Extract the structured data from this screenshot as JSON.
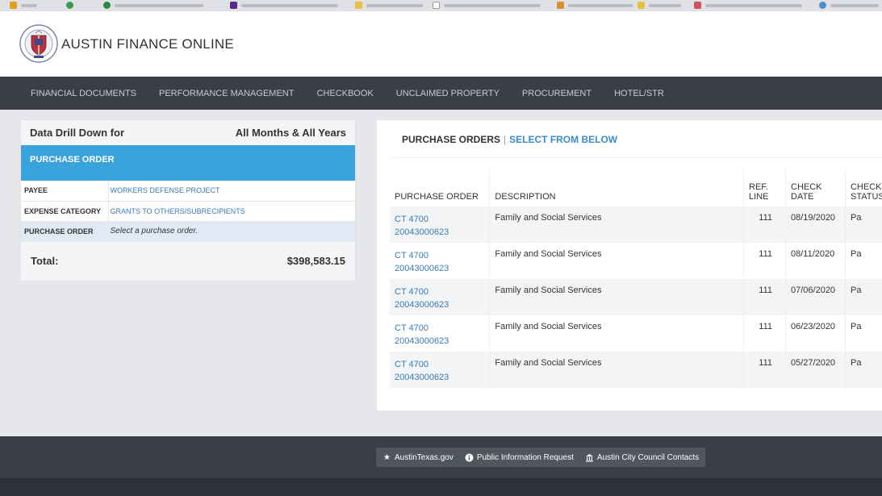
{
  "app": {
    "title": "AUSTIN FINANCE ONLINE"
  },
  "nav": {
    "items": [
      "FINANCIAL DOCUMENTS",
      "PERFORMANCE MANAGEMENT",
      "CHECKBOOK",
      "UNCLAIMED PROPERTY",
      "PROCUREMENT",
      "HOTEL/STR"
    ]
  },
  "drill": {
    "heading": "Data Drill Down for",
    "scope": "All Months & All Years",
    "banner": "PURCHASE ORDER",
    "filters": [
      {
        "key": "PAYEE",
        "value": "WORKERS DEFENSE PROJECT"
      },
      {
        "key": "EXPENSE CATEGORY",
        "value": "GRANTS TO OTHERS/SUBRECIPIENTS"
      },
      {
        "key": "PURCHASE ORDER",
        "value": "Select a purchase order."
      }
    ],
    "total_label": "Total:",
    "total_value": "$398,583.15"
  },
  "orders": {
    "title": "PURCHASE ORDERS",
    "separator": "|",
    "subtitle": "SELECT FROM BELOW",
    "columns": {
      "po": "PURCHASE ORDER",
      "desc": "DESCRIPTION",
      "ref_1": "REF.",
      "ref_2": "LINE",
      "date_1": "CHECK",
      "date_2": "DATE",
      "status_1": "CHECK",
      "status_2": "STATUS"
    },
    "rows": [
      {
        "po_1": "CT 4700",
        "po_2": "20043000623",
        "desc": "Family and Social Services",
        "ref": "111",
        "date": "08/19/2020",
        "status": "Pa"
      },
      {
        "po_1": "CT 4700",
        "po_2": "20043000623",
        "desc": "Family and Social Services",
        "ref": "111",
        "date": "08/11/2020",
        "status": "Pa"
      },
      {
        "po_1": "CT 4700",
        "po_2": "20043000623",
        "desc": "Family and Social Services",
        "ref": "111",
        "date": "07/06/2020",
        "status": "Pa"
      },
      {
        "po_1": "CT 4700",
        "po_2": "20043000623",
        "desc": "Family and Social Services",
        "ref": "111",
        "date": "06/23/2020",
        "status": "Pa"
      },
      {
        "po_1": "CT 4700",
        "po_2": "20043000623",
        "desc": "Family and Social Services",
        "ref": "111",
        "date": "05/27/2020",
        "status": "Pa"
      }
    ]
  },
  "footer": {
    "links": [
      {
        "icon": "star-icon",
        "label": "AustinTexas.gov"
      },
      {
        "icon": "info-icon",
        "label": "Public Information Request"
      },
      {
        "icon": "capitol-icon",
        "label": "Austin City Council Contacts"
      }
    ]
  },
  "colors": {
    "accent": "#3aa3dc",
    "nav_bg": "#3a3f47",
    "link": "#3a7ab5"
  }
}
